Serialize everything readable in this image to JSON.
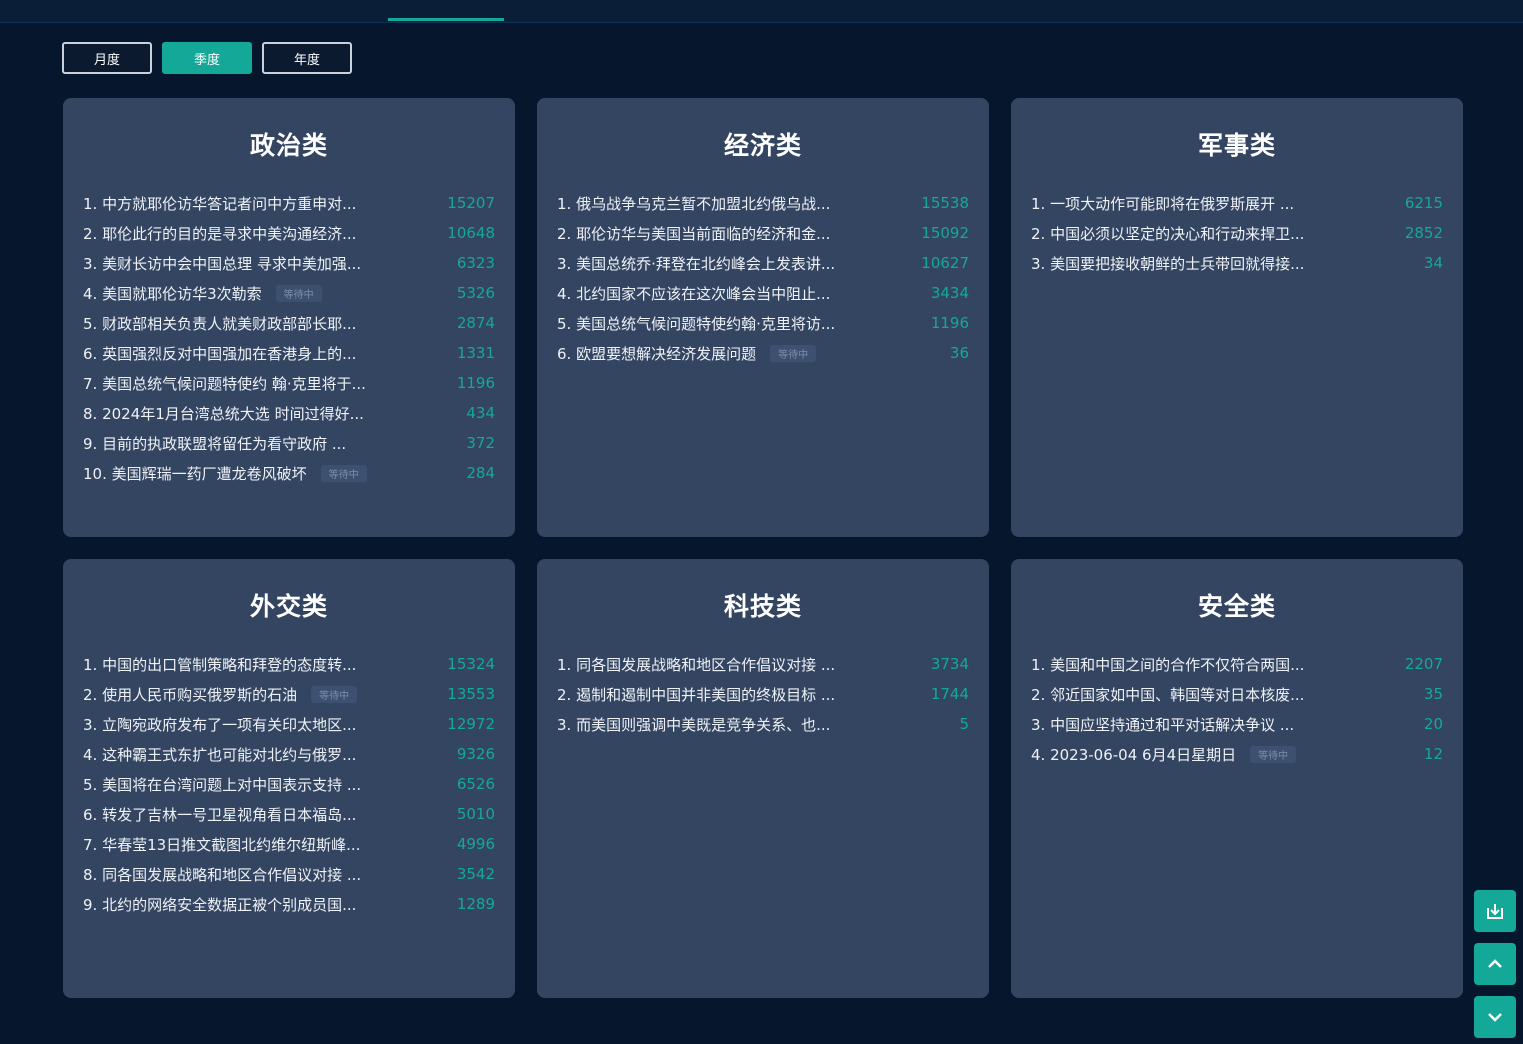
{
  "period_tabs": [
    {
      "label": "月度",
      "active": false
    },
    {
      "label": "季度",
      "active": true
    },
    {
      "label": "年度",
      "active": false
    }
  ],
  "accent_color": "#14a898",
  "categories": [
    {
      "title": "政治类",
      "items": [
        {
          "title": "1. 中方就耶伦访华答记者问中方重申对...",
          "count": "15207",
          "badge": ""
        },
        {
          "title": "2. 耶伦此行的目的是寻求中美沟通经济...",
          "count": "10648",
          "badge": ""
        },
        {
          "title": "3. 美财长访中会中国总理 寻求中美加强...",
          "count": "6323",
          "badge": ""
        },
        {
          "title": "4. 美国就耶伦访华3次勒索",
          "count": "5326",
          "badge": "等待中"
        },
        {
          "title": "5. 财政部相关负责人就美财政部部长耶...",
          "count": "2874",
          "badge": ""
        },
        {
          "title": "6. 英国强烈反对中国强加在香港身上的...",
          "count": "1331",
          "badge": ""
        },
        {
          "title": "7. 美国总统气候问题特使约 翰·克里将于...",
          "count": "1196",
          "badge": ""
        },
        {
          "title": "8. 2024年1月台湾总统大选 时间过得好...",
          "count": "434",
          "badge": ""
        },
        {
          "title": "9. 目前的执政联盟将留任为看守政府 ...",
          "count": "372",
          "badge": ""
        },
        {
          "title": "10. 美国辉瑞一药厂遭龙卷风破坏",
          "count": "284",
          "badge": "等待中"
        }
      ]
    },
    {
      "title": "经济类",
      "items": [
        {
          "title": "1. 俄乌战争乌克兰暂不加盟北约俄乌战...",
          "count": "15538",
          "badge": ""
        },
        {
          "title": "2. 耶伦访华与美国当前面临的经济和金...",
          "count": "15092",
          "badge": ""
        },
        {
          "title": "3. 美国总统乔·拜登在北约峰会上发表讲...",
          "count": "10627",
          "badge": ""
        },
        {
          "title": "4. 北约国家不应该在这次峰会当中阻止...",
          "count": "3434",
          "badge": ""
        },
        {
          "title": "5. 美国总统气候问题特使约翰·克里将访...",
          "count": "1196",
          "badge": ""
        },
        {
          "title": "6. 欧盟要想解决经济发展问题",
          "count": "36",
          "badge": "等待中"
        }
      ]
    },
    {
      "title": "军事类",
      "items": [
        {
          "title": "1. 一项大动作可能即将在俄罗斯展开 ...",
          "count": "6215",
          "badge": ""
        },
        {
          "title": "2. 中国必须以坚定的决心和行动来捍卫...",
          "count": "2852",
          "badge": ""
        },
        {
          "title": "3. 美国要把接收朝鲜的士兵带回就得接...",
          "count": "34",
          "badge": ""
        }
      ]
    },
    {
      "title": "外交类",
      "items": [
        {
          "title": "1. 中国的出口管制策略和拜登的态度转...",
          "count": "15324",
          "badge": ""
        },
        {
          "title": "2. 使用人民币购买俄罗斯的石油",
          "count": "13553",
          "badge": "等待中"
        },
        {
          "title": "3. 立陶宛政府发布了一项有关印太地区...",
          "count": "12972",
          "badge": ""
        },
        {
          "title": "4. 这种霸王式东扩也可能对北约与俄罗...",
          "count": "9326",
          "badge": ""
        },
        {
          "title": "5. 美国将在台湾问题上对中国表示支持 ...",
          "count": "6526",
          "badge": ""
        },
        {
          "title": "6. 转发了吉林一号卫星视角看日本福岛...",
          "count": "5010",
          "badge": ""
        },
        {
          "title": "7. 华春莹13日推文截图北约维尔纽斯峰...",
          "count": "4996",
          "badge": ""
        },
        {
          "title": "8. 同各国发展战略和地区合作倡议对接 ...",
          "count": "3542",
          "badge": ""
        },
        {
          "title": "9. 北约的网络安全数据正被个别成员国...",
          "count": "1289",
          "badge": ""
        }
      ]
    },
    {
      "title": "科技类",
      "items": [
        {
          "title": "1. 同各国发展战略和地区合作倡议对接 ...",
          "count": "3734",
          "badge": ""
        },
        {
          "title": "2. 遏制和遏制中国并非美国的终极目标 ...",
          "count": "1744",
          "badge": ""
        },
        {
          "title": "3. 而美国则强调中美既是竞争关系、也...",
          "count": "5",
          "badge": ""
        }
      ]
    },
    {
      "title": "安全类",
      "items": [
        {
          "title": "1. 美国和中国之间的合作不仅符合两国...",
          "count": "2207",
          "badge": ""
        },
        {
          "title": "2. 邻近国家如中国、韩国等对日本核废...",
          "count": "35",
          "badge": ""
        },
        {
          "title": "3. 中国应坚持通过和平对话解决争议 ...",
          "count": "20",
          "badge": ""
        },
        {
          "title": "4. 2023-06-04 6月4日星期日",
          "count": "12",
          "badge": "等待中"
        }
      ]
    }
  ],
  "side_tools": [
    {
      "icon": "download-icon"
    },
    {
      "icon": "chevron-up-icon"
    },
    {
      "icon": "chevron-down-icon"
    }
  ]
}
